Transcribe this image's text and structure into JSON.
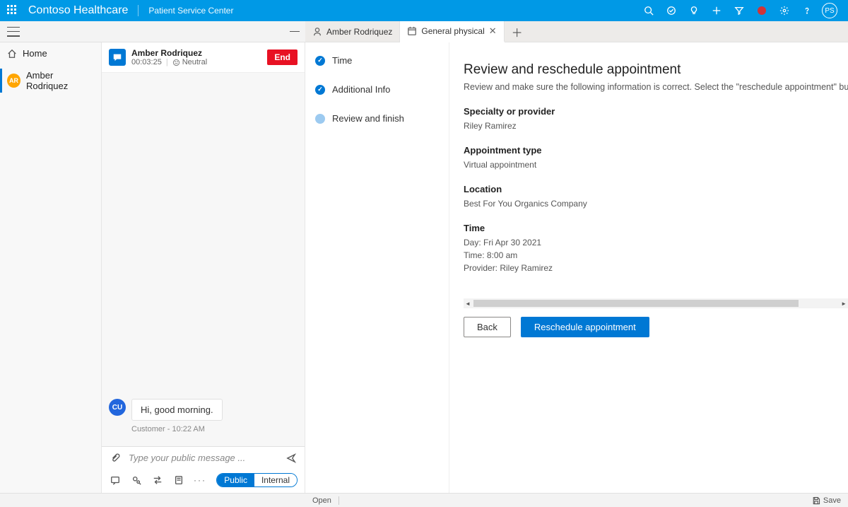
{
  "header": {
    "brand": "Contoso Healthcare",
    "subbrand": "Patient Service Center",
    "user_initials": "PS"
  },
  "left_nav": {
    "home": "Home",
    "item_initials": "AR",
    "item_label": "Amber Rodriquez"
  },
  "tabs": [
    {
      "label": "Amber Rodriquez",
      "icon": "person",
      "active": false
    },
    {
      "label": "General physical",
      "icon": "calendar",
      "active": true
    }
  ],
  "chat": {
    "name": "Amber Rodriquez",
    "timer": "00:03:25",
    "sentiment": "Neutral",
    "end_label": "End",
    "message_avatar": "CU",
    "message_text": "Hi, good morning.",
    "message_meta": "Customer - 10:22 AM",
    "compose_placeholder": "Type your public message ...",
    "toggle_public": "Public",
    "toggle_internal": "Internal"
  },
  "steps": [
    {
      "label": "Time",
      "state": "done"
    },
    {
      "label": "Additional Info",
      "state": "done"
    },
    {
      "label": "Review and finish",
      "state": "current"
    }
  ],
  "detail": {
    "title": "Review and reschedule appointment",
    "subtitle": "Review and make sure the following information is correct. Select the \"reschedule appointment\" button below to update th",
    "fields": {
      "specialty_label": "Specialty or provider",
      "specialty_value": "Riley Ramirez",
      "type_label": "Appointment type",
      "type_value": "Virtual appointment",
      "location_label": "Location",
      "location_value": "Best For You Organics Company",
      "time_label": "Time",
      "time_value_day": "Day: Fri Apr 30 2021",
      "time_value_time": "Time: 8:00 am",
      "time_value_provider": "Provider: Riley Ramirez"
    },
    "back_label": "Back",
    "primary_label": "Reschedule appointment"
  },
  "statusbar": {
    "open": "Open",
    "save": "Save"
  }
}
